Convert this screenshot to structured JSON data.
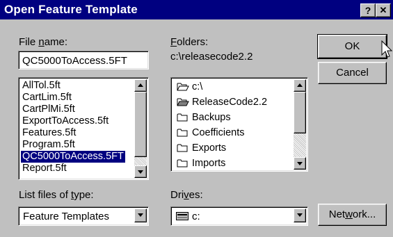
{
  "window": {
    "title": "Open Feature Template"
  },
  "titlebar_buttons": {
    "help": "?",
    "close": "✕"
  },
  "filename": {
    "label_pre": "File ",
    "label_key": "n",
    "label_post": "ame:",
    "value": "QC5000ToAccess.5FT"
  },
  "files": {
    "items": [
      "AllTol.5ft",
      "CartLim.5ft",
      "CartPlMi.5ft",
      "ExportToAccess.5ft",
      "Features.5ft",
      "Program.5ft",
      "QC5000ToAccess.5FT",
      "Report.5ft"
    ],
    "selected_index": 6
  },
  "folders": {
    "label_pre": "",
    "label_key": "F",
    "label_post": "olders:",
    "path": "c:\\releasecode2.2",
    "items": [
      {
        "label": "c:\\",
        "icon": "open-folder-icon"
      },
      {
        "label": "ReleaseCode2.2",
        "icon": "open-folder-filled-icon"
      },
      {
        "label": "Backups",
        "icon": "folder-icon"
      },
      {
        "label": "Coefficients",
        "icon": "folder-icon"
      },
      {
        "label": "Exports",
        "icon": "folder-icon"
      },
      {
        "label": "Imports",
        "icon": "folder-icon"
      }
    ]
  },
  "filetype": {
    "label_pre": "List files of ",
    "label_key": "t",
    "label_post": "ype:",
    "value": "Feature Templates"
  },
  "drives": {
    "label_pre": "Dri",
    "label_key": "v",
    "label_post": "es:",
    "value": "c:"
  },
  "buttons": {
    "ok": "OK",
    "cancel": "Cancel",
    "network_pre": "Net",
    "network_key": "w",
    "network_post": "ork..."
  }
}
